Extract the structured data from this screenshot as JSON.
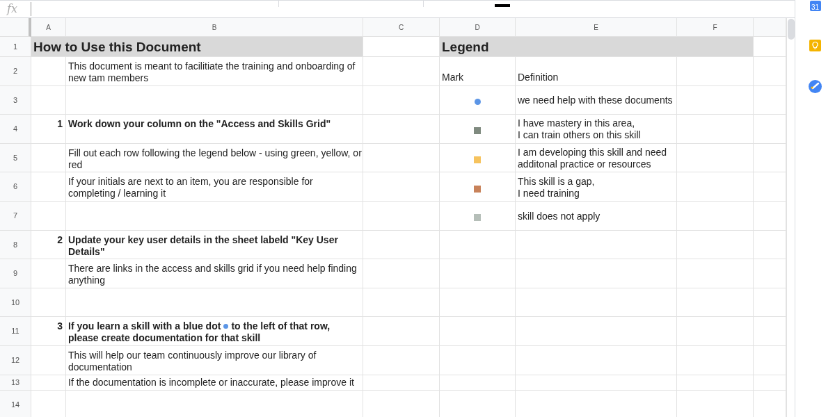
{
  "formula_bar": {
    "fx": "fx"
  },
  "columns": [
    "A",
    "B",
    "C",
    "D",
    "E",
    "F"
  ],
  "title_row": {
    "row": "1",
    "left": "How to Use this Document",
    "right": "Legend"
  },
  "rows": [
    {
      "row": "2",
      "short": false,
      "bold": false,
      "text": "This document is meant to facilitiate the training and onboarding of new tam members",
      "mark_header": "Mark",
      "definition": "Definition"
    },
    {
      "row": "3",
      "short": false,
      "bold": false,
      "mark": {
        "kind": "dot",
        "color": "#5b95e6"
      },
      "definition": "we need help with these documents"
    },
    {
      "row": "4",
      "short": false,
      "bold": true,
      "step": "1",
      "text": "Work down your column on the \"Access and Skills Grid\"",
      "mark": {
        "kind": "square",
        "color": "#7f8a7f"
      },
      "definition": "I have mastery in this area,\nI can train others on this skill"
    },
    {
      "row": "5",
      "short": false,
      "bold": false,
      "text": "Fill out each row following the legend below - using green, yellow, or red",
      "mark": {
        "kind": "square",
        "color": "#f6c35e"
      },
      "definition": "I am developing this skill and need additonal practice or resources"
    },
    {
      "row": "6",
      "short": false,
      "bold": false,
      "text": "If your initials are next to an item, you are responsible for completing / learning it",
      "mark": {
        "kind": "square",
        "color": "#c8825a"
      },
      "definition": "This skill is a gap,\nI need training"
    },
    {
      "row": "7",
      "short": false,
      "bold": false,
      "mark": {
        "kind": "square",
        "color": "#b5beb8"
      },
      "definition": "skill does not apply"
    },
    {
      "row": "8",
      "short": false,
      "bold": true,
      "step": "2",
      "text": "Update your key user details in the sheet labeld \"Key User Details\""
    },
    {
      "row": "9",
      "short": false,
      "bold": false,
      "text": "There are links in the access and skills grid if you need help finding anything"
    },
    {
      "row": "10",
      "short": false,
      "bold": false
    },
    {
      "row": "11",
      "short": false,
      "bold": true,
      "step": "3",
      "text": "If you learn a skill with a blue dot",
      "inline_dot": {
        "color": "#5b95e6"
      },
      "text_after": "to the left of that row,",
      "text_line2": "please create documentation for that skill"
    },
    {
      "row": "12",
      "short": false,
      "bold": false,
      "text": "This will help our team continuously improve our library of documentation"
    },
    {
      "row": "13",
      "short": true,
      "bold": false,
      "text": "If the documentation is incomplete or inaccurate, please improve it"
    },
    {
      "row": "14",
      "short": false,
      "bold": false
    }
  ],
  "side_panel": {
    "calendar_day": "31"
  }
}
